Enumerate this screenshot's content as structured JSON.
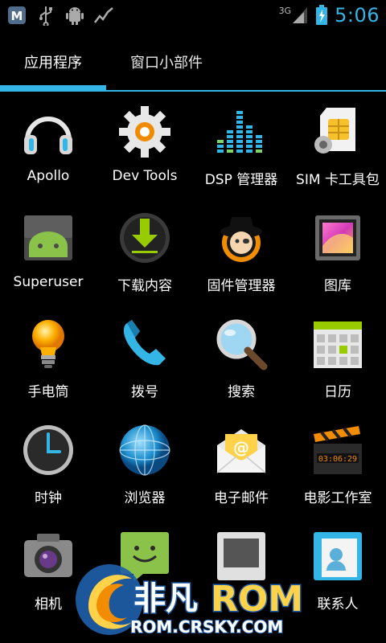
{
  "status_bar": {
    "network": "3G",
    "time": "5:06",
    "icons": [
      "app-notification-icon",
      "usb-icon",
      "android-debug-icon",
      "activity-graph-icon",
      "signal-icon",
      "battery-icon"
    ]
  },
  "tabs": [
    {
      "label": "应用程序",
      "active": true
    },
    {
      "label": "窗口小部件",
      "active": false
    }
  ],
  "accent_color": "#33b5e5",
  "apps": [
    {
      "label": "Apollo",
      "icon": "headphones-icon"
    },
    {
      "label": "Dev Tools",
      "icon": "dev-tools-gear-icon"
    },
    {
      "label": "DSP 管理器",
      "icon": "equalizer-icon"
    },
    {
      "label": "SIM 卡工具包",
      "icon": "sim-card-icon"
    },
    {
      "label": "Superuser",
      "icon": "superuser-android-icon"
    },
    {
      "label": "下载内容",
      "icon": "download-icon"
    },
    {
      "label": "固件管理器",
      "icon": "rom-manager-icon"
    },
    {
      "label": "图库",
      "icon": "gallery-icon"
    },
    {
      "label": "手电筒",
      "icon": "lightbulb-icon"
    },
    {
      "label": "拨号",
      "icon": "phone-icon"
    },
    {
      "label": "搜索",
      "icon": "magnifier-icon"
    },
    {
      "label": "日历",
      "icon": "calendar-icon"
    },
    {
      "label": "时钟",
      "icon": "clock-icon"
    },
    {
      "label": "浏览器",
      "icon": "globe-icon"
    },
    {
      "label": "电子邮件",
      "icon": "email-icon"
    },
    {
      "label": "电影工作室",
      "icon": "clapperboard-icon"
    },
    {
      "label": "相机",
      "icon": "camera-icon"
    },
    {
      "label": "",
      "icon": "messaging-icon"
    },
    {
      "label": "",
      "icon": "file-manager-icon"
    },
    {
      "label": "联系人",
      "icon": "contacts-icon"
    }
  ],
  "watermark": {
    "brand": "非凡",
    "rom": "ROM",
    "url": "ROM.CRSKY.COM"
  }
}
